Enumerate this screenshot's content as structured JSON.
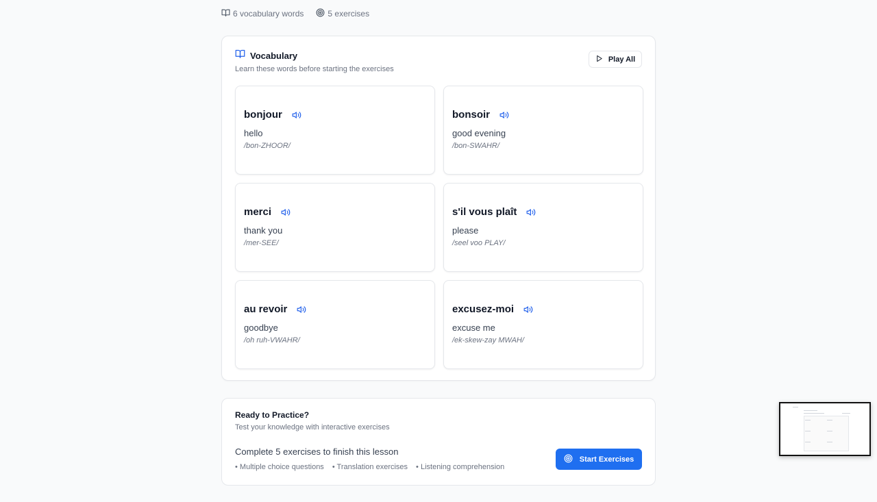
{
  "meta": {
    "vocab_count": "6 vocabulary words",
    "exercise_count": "5 exercises"
  },
  "vocabulary": {
    "title": "Vocabulary",
    "subtitle": "Learn these words before starting the exercises",
    "play_all_label": "Play All",
    "words": [
      {
        "word": "bonjour",
        "translation": "hello",
        "pronunciation": "/bon-ZHOOR/"
      },
      {
        "word": "bonsoir",
        "translation": "good evening",
        "pronunciation": "/bon-SWAHR/"
      },
      {
        "word": "merci",
        "translation": "thank you",
        "pronunciation": "/mer-SEE/"
      },
      {
        "word": "s'il vous plaît",
        "translation": "please",
        "pronunciation": "/seel voo PLAY/"
      },
      {
        "word": "au revoir",
        "translation": "goodbye",
        "pronunciation": "/oh ruh-VWAHR/"
      },
      {
        "word": "excusez-moi",
        "translation": "excuse me",
        "pronunciation": "/ek-skew-zay MWAH/"
      }
    ]
  },
  "practice": {
    "title": "Ready to Practice?",
    "subtitle": "Test your knowledge with interactive exercises",
    "main_text": "Complete 5 exercises to finish this lesson",
    "bullets": [
      "• Multiple choice questions",
      "• Translation exercises",
      "• Listening comprehension"
    ],
    "start_label": "Start Exercises"
  },
  "colors": {
    "accent": "#1f6ff0",
    "speaker_icon": "#2563eb"
  },
  "icons": {
    "vocab_meta": "book-open-icon",
    "exercise_meta": "target-icon",
    "vocab_title": "book-open-icon",
    "play_all": "play-icon",
    "word_audio": "speaker-icon",
    "start": "target-icon"
  }
}
